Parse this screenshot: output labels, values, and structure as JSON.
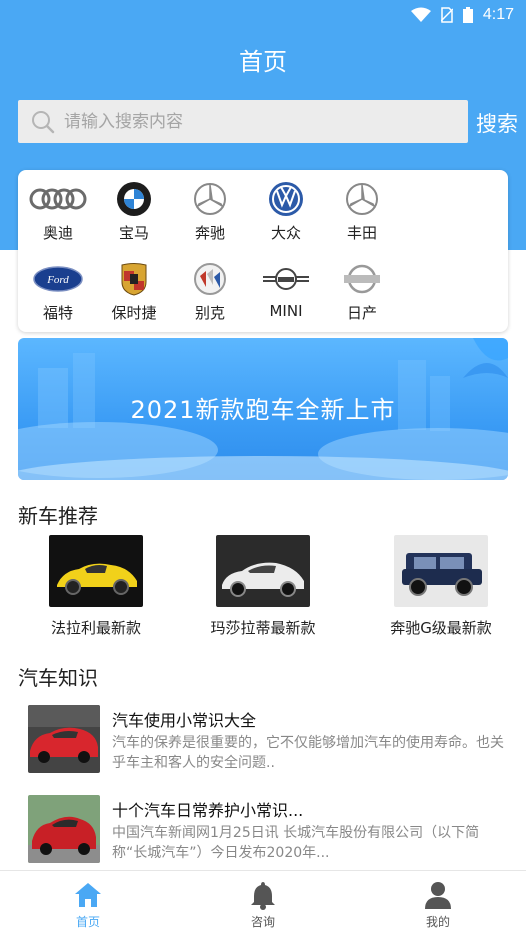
{
  "status": {
    "time": "4:17"
  },
  "header": {
    "title": "首页"
  },
  "search": {
    "placeholder": "请输入搜索内容",
    "button": "搜索"
  },
  "brands": [
    {
      "name": "奥迪",
      "icon": "audi-logo"
    },
    {
      "name": "宝马",
      "icon": "bmw-logo"
    },
    {
      "name": "奔驰",
      "icon": "mercedes-logo"
    },
    {
      "name": "大众",
      "icon": "volkswagen-logo"
    },
    {
      "name": "丰田",
      "icon": "mercedes-logo"
    },
    {
      "name": "福特",
      "icon": "ford-logo"
    },
    {
      "name": "保时捷",
      "icon": "porsche-logo"
    },
    {
      "name": "别克",
      "icon": "buick-logo"
    },
    {
      "name": "MINI",
      "icon": "mini-logo"
    },
    {
      "name": "日产",
      "icon": "nissan-logo"
    }
  ],
  "banner": {
    "text": "2021新款跑车全新上市"
  },
  "new_cars": {
    "title": "新车推荐",
    "items": [
      {
        "name": "法拉利最新款"
      },
      {
        "name": "玛莎拉蒂最新款"
      },
      {
        "name": "奔驰G级最新款"
      }
    ]
  },
  "knowledge": {
    "title": "汽车知识",
    "items": [
      {
        "title": "汽车使用小常识大全",
        "desc": "汽车的保养是很重要的，它不仅能够增加汽车的使用寿命。也关乎车主和客人的安全问题.."
      },
      {
        "title": "十个汽车日常养护小常识...",
        "desc": "中国汽车新闻网1月25日讯 长城汽车股份有限公司（以下简称“长城汽车”）今日发布2020年..."
      }
    ]
  },
  "tabs": [
    {
      "label": "首页",
      "icon": "home-icon",
      "active": true
    },
    {
      "label": "咨询",
      "icon": "bell-icon",
      "active": false
    },
    {
      "label": "我的",
      "icon": "user-icon",
      "active": false
    }
  ],
  "colors": {
    "primary": "#4aa8f4",
    "inactive": "#555555"
  }
}
